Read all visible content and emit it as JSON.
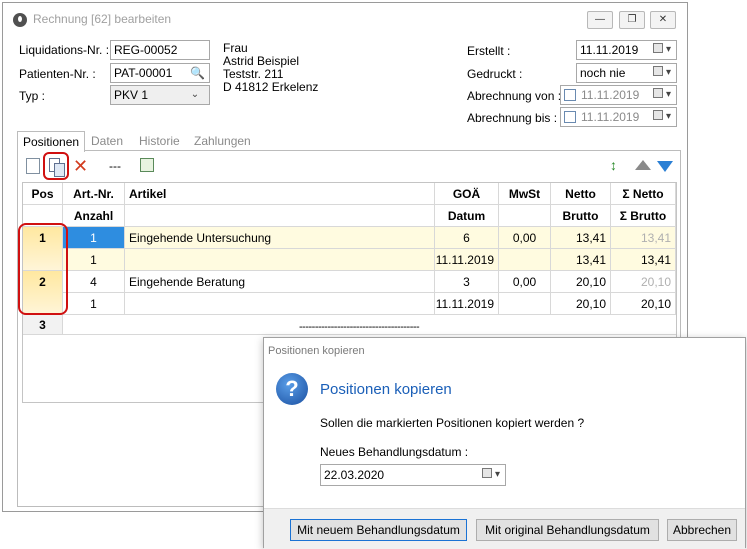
{
  "window": {
    "title": "Rechnung [62] bearbeiten",
    "minimize": "—",
    "maximize": "❐",
    "close": "✕"
  },
  "form": {
    "liquidation_label": "Liquidations-Nr. :",
    "liquidation_value": "REG-00052",
    "patient_label": "Patienten-Nr. :",
    "patient_value": "PAT-00001",
    "type_label": "Typ :",
    "type_value": "PKV 1",
    "address": [
      "Frau",
      "Astrid Beispiel",
      "Teststr. 211",
      "D 41812 Erkelenz"
    ],
    "created_label": "Erstellt :",
    "created_value": "11.11.2019",
    "printed_label": "Gedruckt :",
    "printed_value": "noch nie",
    "billing_from_label": "Abrechnung von :",
    "billing_from_value": "11.11.2019",
    "billing_to_label": "Abrechnung bis :",
    "billing_to_value": "11.11.2019"
  },
  "tabs": [
    "Positionen",
    "Daten",
    "Historie",
    "Zahlungen"
  ],
  "toolbar": {
    "dash": "---"
  },
  "grid": {
    "headers_top": [
      "Pos",
      "Art.-Nr.",
      "Artikel",
      "GOÄ",
      "MwSt",
      "Netto",
      "Σ Netto"
    ],
    "headers_bottom": [
      "Anzahl",
      "Datum",
      "Brutto",
      "Σ Brutto"
    ],
    "rows": [
      {
        "pos": "1",
        "art_nr": "1",
        "artikel": "Eingehende Untersuchung",
        "goae": "6",
        "mwst": "0,00",
        "netto": "13,41",
        "sum_netto": "13,41",
        "anzahl": "1",
        "datum": "11.11.2019",
        "brutto": "13,41",
        "sum_brutto": "13,41"
      },
      {
        "pos": "2",
        "art_nr": "4",
        "artikel": "Eingehende Beratung",
        "goae": "3",
        "mwst": "0,00",
        "netto": "20,10",
        "sum_netto": "20,10",
        "anzahl": "1",
        "datum": "11.11.2019",
        "brutto": "20,10",
        "sum_brutto": "20,10"
      }
    ],
    "new_row_pos": "3",
    "dashes": "--------------------------------------"
  },
  "dialog": {
    "window_title": "Positionen kopieren",
    "heading": "Positionen kopieren",
    "message": "Sollen die markierten Positionen kopiert werden ?",
    "date_label": "Neues Behandlungsdatum :",
    "date_value": "22.03.2020",
    "btn_new_date": "Mit neuem Behandlungsdatum",
    "btn_orig_date": "Mit original Behandlungsdatum",
    "btn_cancel": "Abbrechen"
  },
  "colors": {
    "accent": "#2e8de0",
    "highlight_marker": "#d01010",
    "row_yellow": "#fffbe0"
  }
}
